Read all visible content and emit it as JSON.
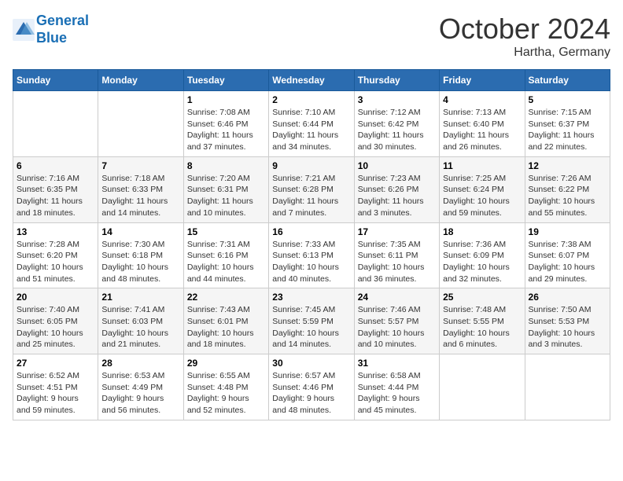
{
  "header": {
    "logo_line1": "General",
    "logo_line2": "Blue",
    "month": "October 2024",
    "location": "Hartha, Germany"
  },
  "weekdays": [
    "Sunday",
    "Monday",
    "Tuesday",
    "Wednesday",
    "Thursday",
    "Friday",
    "Saturday"
  ],
  "weeks": [
    [
      {
        "day": "",
        "info": ""
      },
      {
        "day": "",
        "info": ""
      },
      {
        "day": "1",
        "info": "Sunrise: 7:08 AM\nSunset: 6:46 PM\nDaylight: 11 hours\nand 37 minutes."
      },
      {
        "day": "2",
        "info": "Sunrise: 7:10 AM\nSunset: 6:44 PM\nDaylight: 11 hours\nand 34 minutes."
      },
      {
        "day": "3",
        "info": "Sunrise: 7:12 AM\nSunset: 6:42 PM\nDaylight: 11 hours\nand 30 minutes."
      },
      {
        "day": "4",
        "info": "Sunrise: 7:13 AM\nSunset: 6:40 PM\nDaylight: 11 hours\nand 26 minutes."
      },
      {
        "day": "5",
        "info": "Sunrise: 7:15 AM\nSunset: 6:37 PM\nDaylight: 11 hours\nand 22 minutes."
      }
    ],
    [
      {
        "day": "6",
        "info": "Sunrise: 7:16 AM\nSunset: 6:35 PM\nDaylight: 11 hours\nand 18 minutes."
      },
      {
        "day": "7",
        "info": "Sunrise: 7:18 AM\nSunset: 6:33 PM\nDaylight: 11 hours\nand 14 minutes."
      },
      {
        "day": "8",
        "info": "Sunrise: 7:20 AM\nSunset: 6:31 PM\nDaylight: 11 hours\nand 10 minutes."
      },
      {
        "day": "9",
        "info": "Sunrise: 7:21 AM\nSunset: 6:28 PM\nDaylight: 11 hours\nand 7 minutes."
      },
      {
        "day": "10",
        "info": "Sunrise: 7:23 AM\nSunset: 6:26 PM\nDaylight: 11 hours\nand 3 minutes."
      },
      {
        "day": "11",
        "info": "Sunrise: 7:25 AM\nSunset: 6:24 PM\nDaylight: 10 hours\nand 59 minutes."
      },
      {
        "day": "12",
        "info": "Sunrise: 7:26 AM\nSunset: 6:22 PM\nDaylight: 10 hours\nand 55 minutes."
      }
    ],
    [
      {
        "day": "13",
        "info": "Sunrise: 7:28 AM\nSunset: 6:20 PM\nDaylight: 10 hours\nand 51 minutes."
      },
      {
        "day": "14",
        "info": "Sunrise: 7:30 AM\nSunset: 6:18 PM\nDaylight: 10 hours\nand 48 minutes."
      },
      {
        "day": "15",
        "info": "Sunrise: 7:31 AM\nSunset: 6:16 PM\nDaylight: 10 hours\nand 44 minutes."
      },
      {
        "day": "16",
        "info": "Sunrise: 7:33 AM\nSunset: 6:13 PM\nDaylight: 10 hours\nand 40 minutes."
      },
      {
        "day": "17",
        "info": "Sunrise: 7:35 AM\nSunset: 6:11 PM\nDaylight: 10 hours\nand 36 minutes."
      },
      {
        "day": "18",
        "info": "Sunrise: 7:36 AM\nSunset: 6:09 PM\nDaylight: 10 hours\nand 32 minutes."
      },
      {
        "day": "19",
        "info": "Sunrise: 7:38 AM\nSunset: 6:07 PM\nDaylight: 10 hours\nand 29 minutes."
      }
    ],
    [
      {
        "day": "20",
        "info": "Sunrise: 7:40 AM\nSunset: 6:05 PM\nDaylight: 10 hours\nand 25 minutes."
      },
      {
        "day": "21",
        "info": "Sunrise: 7:41 AM\nSunset: 6:03 PM\nDaylight: 10 hours\nand 21 minutes."
      },
      {
        "day": "22",
        "info": "Sunrise: 7:43 AM\nSunset: 6:01 PM\nDaylight: 10 hours\nand 18 minutes."
      },
      {
        "day": "23",
        "info": "Sunrise: 7:45 AM\nSunset: 5:59 PM\nDaylight: 10 hours\nand 14 minutes."
      },
      {
        "day": "24",
        "info": "Sunrise: 7:46 AM\nSunset: 5:57 PM\nDaylight: 10 hours\nand 10 minutes."
      },
      {
        "day": "25",
        "info": "Sunrise: 7:48 AM\nSunset: 5:55 PM\nDaylight: 10 hours\nand 6 minutes."
      },
      {
        "day": "26",
        "info": "Sunrise: 7:50 AM\nSunset: 5:53 PM\nDaylight: 10 hours\nand 3 minutes."
      }
    ],
    [
      {
        "day": "27",
        "info": "Sunrise: 6:52 AM\nSunset: 4:51 PM\nDaylight: 9 hours\nand 59 minutes."
      },
      {
        "day": "28",
        "info": "Sunrise: 6:53 AM\nSunset: 4:49 PM\nDaylight: 9 hours\nand 56 minutes."
      },
      {
        "day": "29",
        "info": "Sunrise: 6:55 AM\nSunset: 4:48 PM\nDaylight: 9 hours\nand 52 minutes."
      },
      {
        "day": "30",
        "info": "Sunrise: 6:57 AM\nSunset: 4:46 PM\nDaylight: 9 hours\nand 48 minutes."
      },
      {
        "day": "31",
        "info": "Sunrise: 6:58 AM\nSunset: 4:44 PM\nDaylight: 9 hours\nand 45 minutes."
      },
      {
        "day": "",
        "info": ""
      },
      {
        "day": "",
        "info": ""
      }
    ]
  ]
}
